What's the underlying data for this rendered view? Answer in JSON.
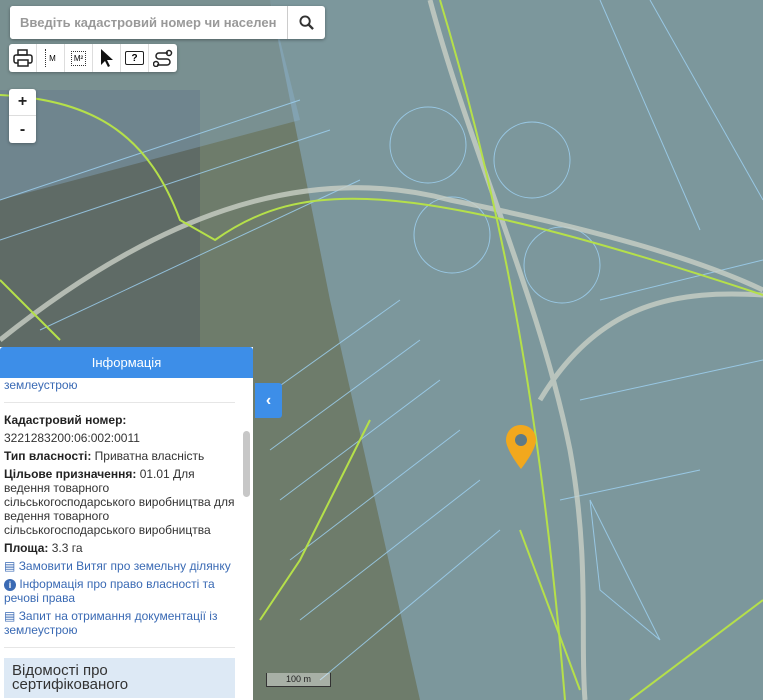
{
  "search": {
    "placeholder": "Введіть кадастровий номер чи населений пункт"
  },
  "panel": {
    "title": "Інформація",
    "top_fragment": "землеустрою",
    "cadastral_label": "Кадастровий номер:",
    "cadastral_value": "3221283200:06:002:0011",
    "ownership_label": "Тип власності:",
    "ownership_value": "Приватна власність",
    "purpose_label": "Цільове призначення:",
    "purpose_value": "01.01 Для ведення товарного сільськогосподарського виробництва для ведення товарного сільськогосподарського виробництва",
    "area_label": "Площа:",
    "area_value": "3.3 га",
    "links": [
      "Замовити Витяг про земельну ділянку",
      "Інформація про право власності та речові права",
      "Запит на отримання документації із землеустрою"
    ],
    "cert_text": "Відомості про сертифікованого"
  },
  "zoom": {
    "in": "+",
    "out": "-"
  },
  "toggle": "‹",
  "scale": "100 m",
  "tools": {
    "measure_length": "M",
    "measure_area": "M²",
    "help": "?"
  }
}
